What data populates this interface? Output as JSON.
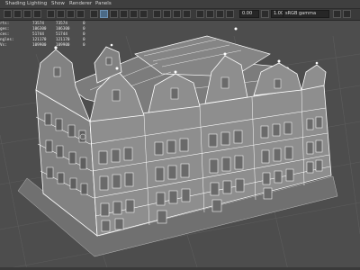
{
  "menubar": {
    "items": [
      "Shading",
      "Lighting",
      "Show",
      "Renderer",
      "Panels"
    ]
  },
  "toolbar": {
    "exposure_value": "0.00",
    "gamma_value": "1.00",
    "color_space": "sRGB gamma"
  },
  "hud": {
    "rows": [
      {
        "label": "rts:",
        "v1": "73574",
        "v2": "73574",
        "v3": "0"
      },
      {
        "label": "ges:",
        "v1": "106300",
        "v2": "106300",
        "v3": "0"
      },
      {
        "label": "ces:",
        "v1": "51744",
        "v2": "51744",
        "v3": "0"
      },
      {
        "label": "ngles:",
        "v1": "121170",
        "v2": "121170",
        "v3": "0"
      },
      {
        "label": "Vs:",
        "v1": "109900",
        "v2": "109900",
        "v3": "0"
      }
    ]
  },
  "viewport": {
    "background": "#4d4d4d",
    "wire_color": "#ffffff",
    "surface_color": "#8a8a8a",
    "roof_color": "#7c7c7c",
    "grid_color": "#5c5c5c"
  }
}
